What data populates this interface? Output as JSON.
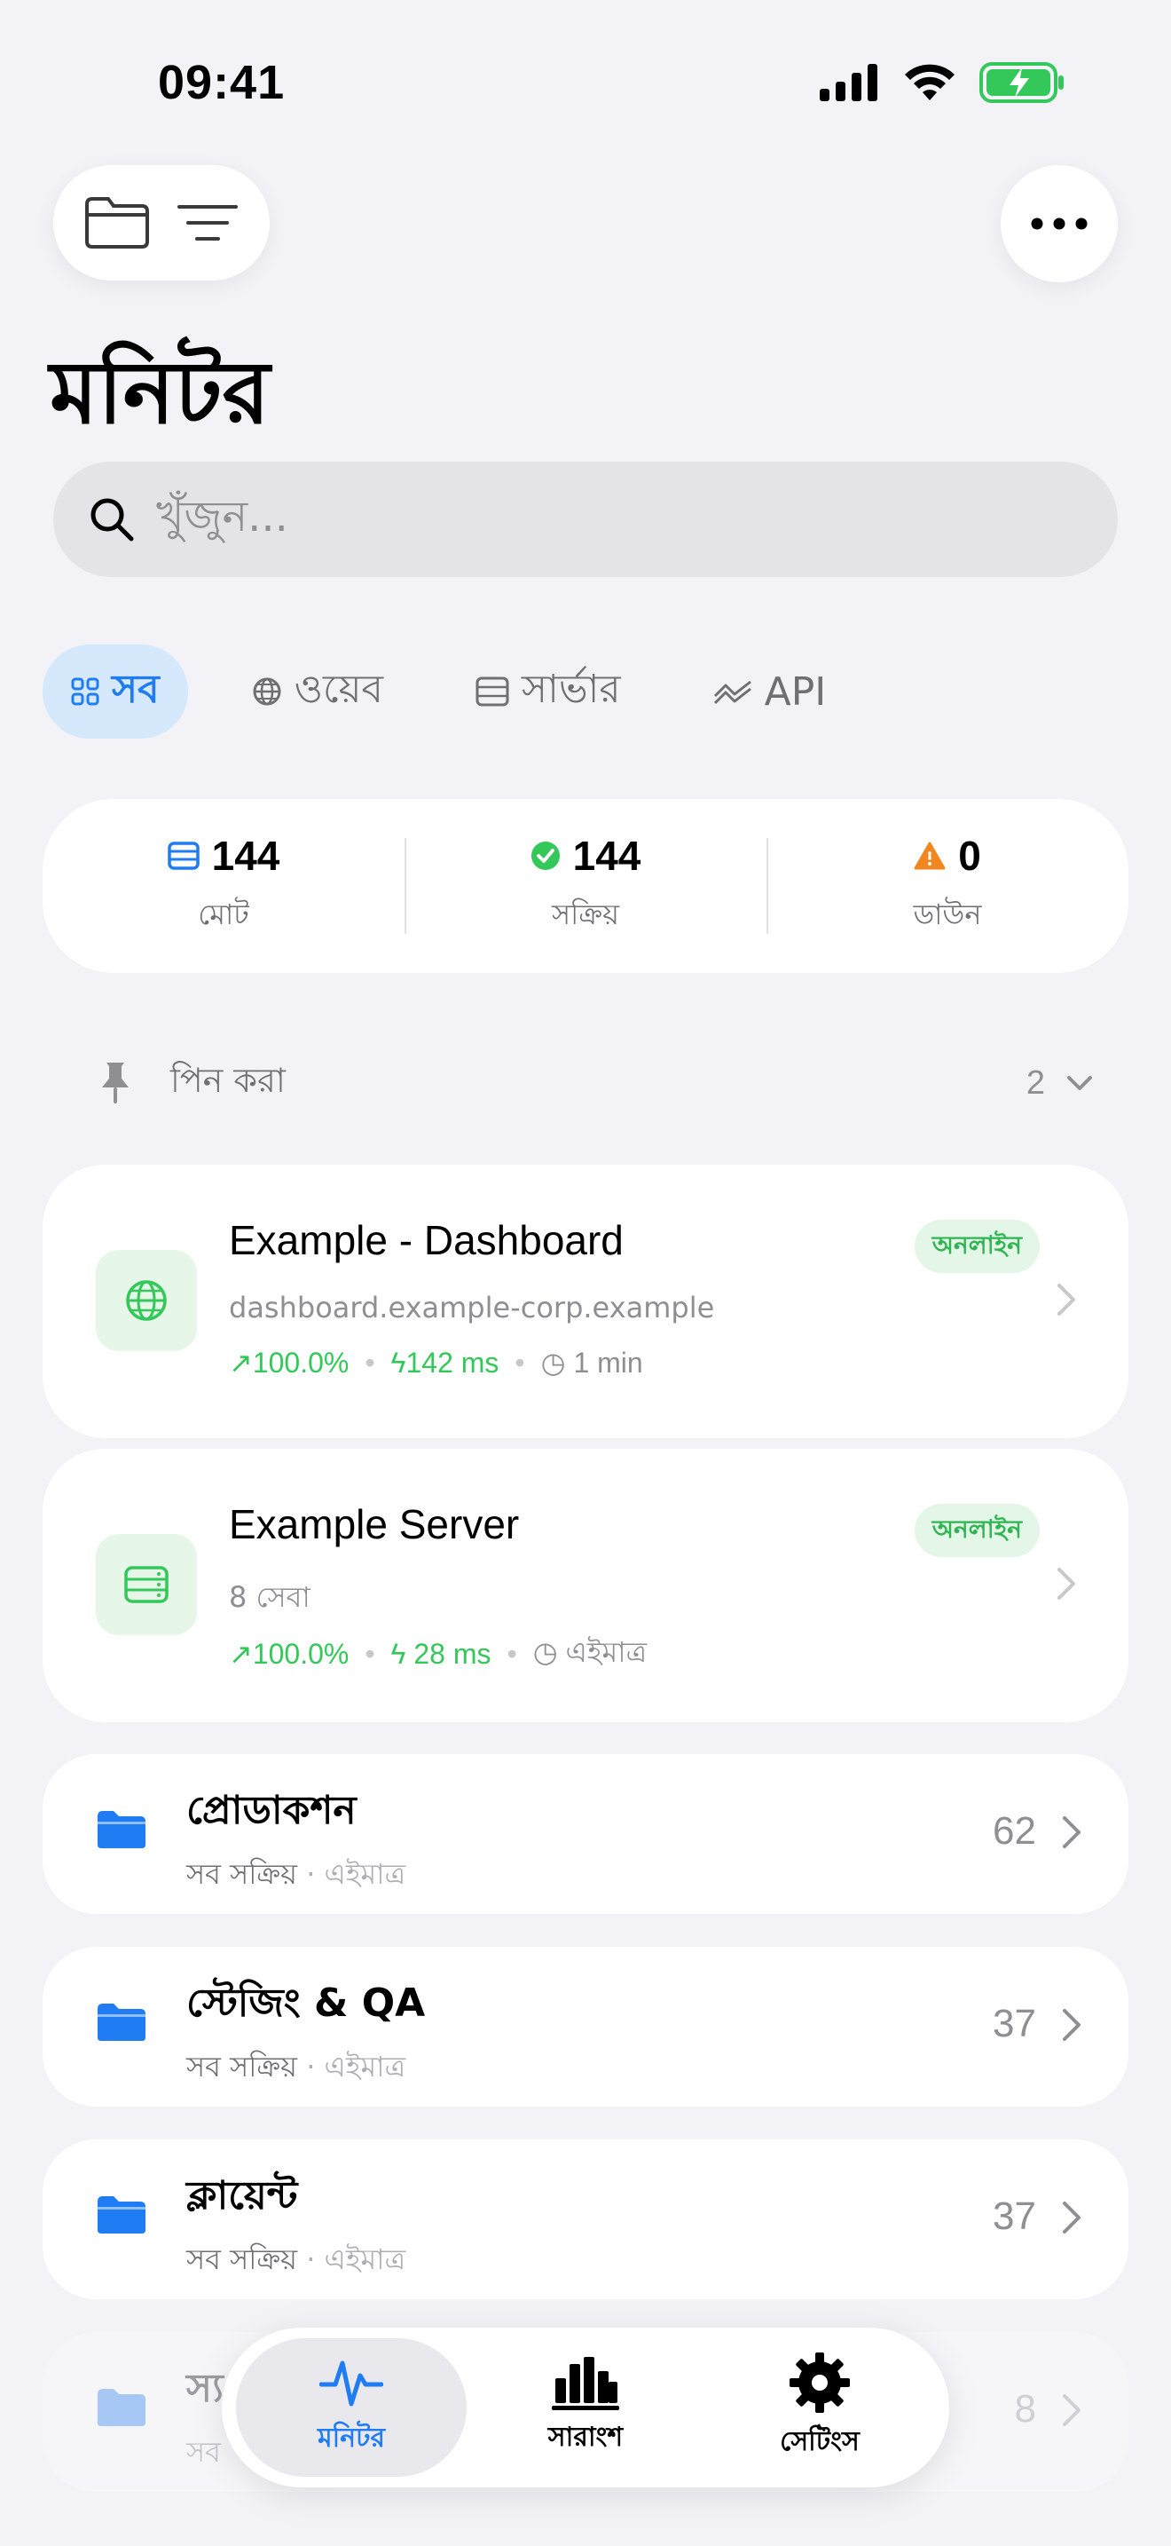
{
  "status_bar": {
    "time": "09:41"
  },
  "page": {
    "title": "মনিটর"
  },
  "search": {
    "placeholder": "খুঁজুন..."
  },
  "filter_tabs": [
    {
      "label": "সব",
      "icon": "grid-icon",
      "active": true
    },
    {
      "label": "ওয়েব",
      "icon": "globe-icon",
      "active": false
    },
    {
      "label": "সার্ভার",
      "icon": "server-icon",
      "active": false
    },
    {
      "label": "API",
      "icon": "api-icon",
      "active": false
    }
  ],
  "stats": {
    "total": {
      "value": "144",
      "label": "মোট"
    },
    "active": {
      "value": "144",
      "label": "সক্রিয়"
    },
    "down": {
      "value": "0",
      "label": "ডাউন"
    }
  },
  "pinned": {
    "label": "পিন করা",
    "count": "2"
  },
  "monitors": [
    {
      "title": "Example - Dashboard",
      "subtitle": "dashboard.example-corp.example",
      "uptime": "100.0%",
      "latency": "142 ms",
      "checked": "1 min",
      "badge": "অনলাইন",
      "icon": "globe-icon"
    },
    {
      "title": "Example Server",
      "subtitle": "8 সেবা",
      "uptime": "100.0%",
      "latency": "28 ms",
      "checked": "এইমাত্র",
      "badge": "অনলাইন",
      "icon": "server-icon"
    }
  ],
  "folders": [
    {
      "title": "প্রোডাকশন",
      "status": "সব সক্রিয়",
      "updated": "এইমাত্র",
      "count": "62"
    },
    {
      "title": "স্টেজিং & QA",
      "status": "সব সক্রিয়",
      "updated": "এইমাত্র",
      "count": "37"
    },
    {
      "title": "ক্লায়েন্ট",
      "status": "সব সক্রিয়",
      "updated": "এইমাত্র",
      "count": "37"
    },
    {
      "title": "স্য",
      "status": "সব",
      "updated": "",
      "count": "8"
    }
  ],
  "tabbar": [
    {
      "label": "মনিটর",
      "icon": "pulse-icon",
      "active": true
    },
    {
      "label": "সারাংশ",
      "icon": "bar-chart-icon",
      "active": false
    },
    {
      "label": "সেটিংস",
      "icon": "gear-icon",
      "active": false
    }
  ],
  "colors": {
    "accent": "#1f7cf3",
    "success": "#34c759",
    "warning": "#f2871f",
    "background": "#f2f2f7"
  }
}
